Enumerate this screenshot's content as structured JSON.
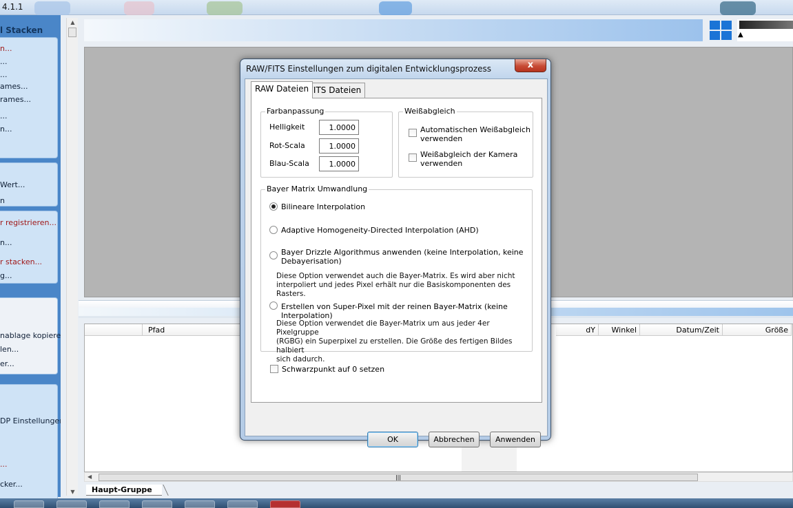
{
  "app": {
    "version": "4.1.1"
  },
  "sidebar": {
    "header": "l Stacken",
    "items": [
      {
        "label": "n...",
        "red": true
      },
      {
        "label": "..."
      },
      {
        "label": "..."
      },
      {
        "label": "ames..."
      },
      {
        "label": "rames..."
      },
      {
        "label": "..."
      },
      {
        "label": "n..."
      },
      {
        "label": "Wert..."
      },
      {
        "label": "n"
      },
      {
        "label": "r registrieren...",
        "red": true
      },
      {
        "label": "n..."
      },
      {
        "label": "r stacken...",
        "red": true
      },
      {
        "label": "g..."
      },
      {
        "label": "nablage kopieren"
      },
      {
        "label": "len..."
      },
      {
        "label": "er..."
      },
      {
        "label": "DP Einstellungen..."
      },
      {
        "label": "...",
        "red": true
      },
      {
        "label": "cker..."
      }
    ]
  },
  "file_table": {
    "columns": [
      "Pfad",
      "dY",
      "Winkel",
      "Datum/Zeit",
      "Größe"
    ]
  },
  "group_tab": "Haupt-Gruppe",
  "dialog": {
    "title": "RAW/FITS Einstellungen zum digitalen Entwicklungsprozess",
    "close_symbol": "x",
    "tabs": [
      "RAW Dateien",
      "FITS Dateien"
    ],
    "color_adjust": {
      "label": "Farbanpassung",
      "brightness_label": "Helligkeit",
      "brightness": "1.0000",
      "red_label": "Rot-Scala",
      "red": "1.0000",
      "blue_label": "Blau-Scala",
      "blue": "1.0000"
    },
    "white_balance": {
      "label": "Weißabgleich",
      "auto_line1": "Automatischen Weißabgleich",
      "auto_line2": "verwenden",
      "camera_line1": "Weißabgleich der Kamera",
      "camera_line2": "verwenden"
    },
    "bayer": {
      "label": "Bayer Matrix Umwandlung",
      "opt_bilinear": "Bilineare Interpolation",
      "opt_ahd": "Adaptive Homogeneity-Directed Interpolation (AHD)",
      "opt_drizzle_line1": "Bayer Drizzle Algorithmus anwenden (keine Interpolation, keine",
      "opt_drizzle_line2": "Debayerisation)",
      "drizzle_desc_line1": "Diese Option verwendet auch die Bayer-Matrix. Es wird aber nicht",
      "drizzle_desc_line2": "interpoliert und jedes Pixel erhält nur die Basiskomponenten des Rasters.",
      "opt_superpixel": "Erstellen von Super-Pixel mit der reinen Bayer-Matrix (keine Interpolation)",
      "superpixel_desc_line1": "Diese Option verwendet die Bayer-Matrix um aus jeder 4er Pixelgruppe",
      "superpixel_desc_line2": "(RGBG) ein Superpixel zu erstellen. Die Größe des fertigen Bildes halbiert",
      "superpixel_desc_line3": "sich dadurch."
    },
    "black_point": "Schwarzpunkt auf 0 setzen",
    "buttons": {
      "ok": "OK",
      "cancel": "Abbrechen",
      "apply": "Anwenden"
    }
  }
}
